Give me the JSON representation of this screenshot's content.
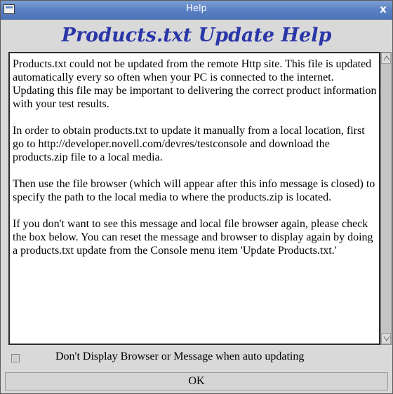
{
  "window": {
    "title": "Help",
    "close_glyph": "x"
  },
  "heading": "Products.txt Update Help",
  "help_paragraphs": [
    "Products.txt could not be updated from the remote Http site.  This file is updated automatically every so often when your PC is connected to the internet.  Updating this file may be important to delivering the correct product information with your test results.",
    "In order to obtain products.txt to update it manually from a local location, first go to http://developer.novell.com/devres/testconsole and download the products.zip file to a local media.",
    "Then use the file browser (which will appear after this info message is closed) to specify the path to the local media to where the products.zip is located.",
    "If you don't want to see this message and local file browser again, please check the box below.  You can reset the message and browser to display again by doing a products.txt update from the Console menu item 'Update Products.txt.'"
  ],
  "checkbox": {
    "label": "Don't Display Browser or Message when auto updating",
    "checked": false
  },
  "ok_label": "OK",
  "colors": {
    "titlebar": "#5a82c4",
    "heading": "#2a36a8",
    "dialog_bg": "#d9d9d9"
  }
}
